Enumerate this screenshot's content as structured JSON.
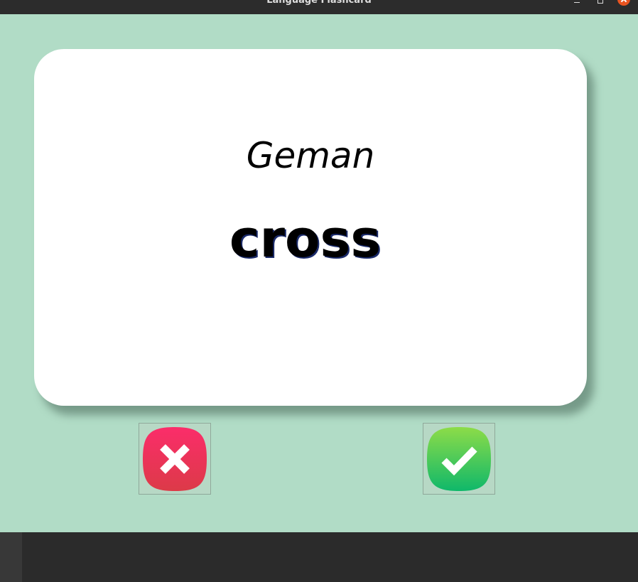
{
  "window": {
    "title": "Language Flashcard"
  },
  "card": {
    "language": "Geman",
    "word": "cross"
  },
  "buttons": {
    "wrong_icon": "cross-icon",
    "right_icon": "checkmark-icon"
  },
  "colors": {
    "background": "#b1dcc6",
    "card": "#ffffff",
    "wrong": "#e8315a",
    "right": "#22c05d"
  }
}
